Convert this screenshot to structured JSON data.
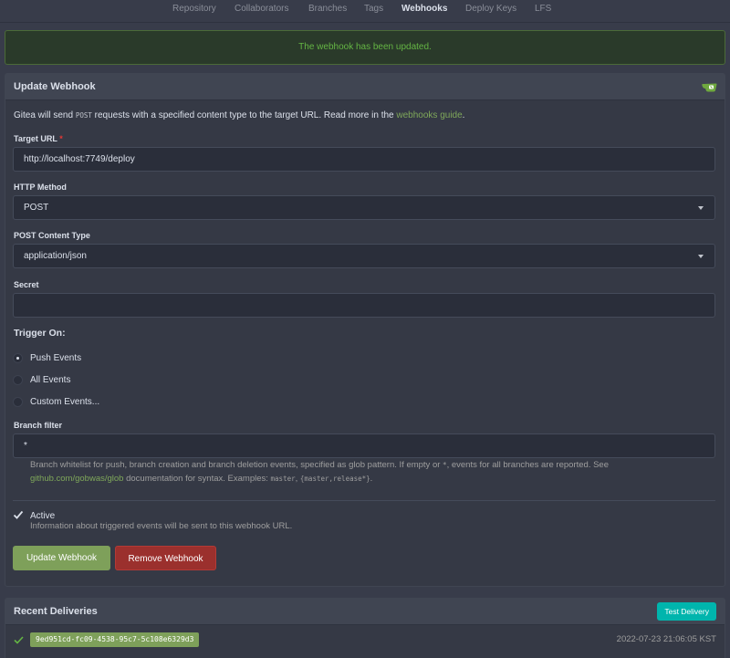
{
  "tabs": [
    "Repository",
    "Collaborators",
    "Branches",
    "Tags",
    "Webhooks",
    "Deploy Keys",
    "LFS"
  ],
  "active_tab": "Webhooks",
  "flash": {
    "message": "The webhook has been updated."
  },
  "form": {
    "title": "Update Webhook",
    "desc_prefix": "Gitea will send ",
    "desc_method": "POST",
    "desc_middle": " requests with a specified content type to the target URL. Read more in the ",
    "desc_link": "webhooks guide",
    "desc_suffix": ".",
    "target_url_label": "Target URL",
    "required_mark": "*",
    "target_url_value": "http://localhost:7749/deploy",
    "http_method_label": "HTTP Method",
    "http_method_value": "POST",
    "content_type_label": "POST Content Type",
    "content_type_value": "application/json",
    "secret_label": "Secret",
    "secret_value": "",
    "trigger_label": "Trigger On:",
    "trigger_options": [
      "Push Events",
      "All Events",
      "Custom Events..."
    ],
    "trigger_selected": "Push Events",
    "branch_filter_label": "Branch filter",
    "branch_filter_value": "*",
    "branch_help_1": "Branch whitelist for push, branch creation and branch deletion events, specified as glob pattern. If empty or ",
    "branch_help_star": "*",
    "branch_help_2": ", events for all branches are reported. See",
    "branch_help_link": "github.com/gobwas/glob",
    "branch_help_3": " documentation for syntax. Examples: ",
    "branch_help_ex1": "master",
    "branch_help_sep": ", ",
    "branch_help_ex2": "{master,release*}",
    "branch_help_end": ".",
    "active_label": "Active",
    "active_checked": true,
    "active_help": "Information about triggered events will be sent to this webhook URL.",
    "update_button": "Update Webhook",
    "remove_button": "Remove Webhook"
  },
  "deliveries": {
    "title": "Recent Deliveries",
    "test_button": "Test Delivery",
    "items": [
      {
        "id": "9ed951cd-fc09-4538-95c7-5c108e6329d3",
        "time": "2022-07-23 21:06:05 KST",
        "status": "success"
      }
    ]
  },
  "colors": {
    "background": "#383c4a",
    "success_text": "#64b544",
    "primary_button": "#7ea05a",
    "danger_button": "#9b302d",
    "teal_button": "#00b5ad"
  }
}
